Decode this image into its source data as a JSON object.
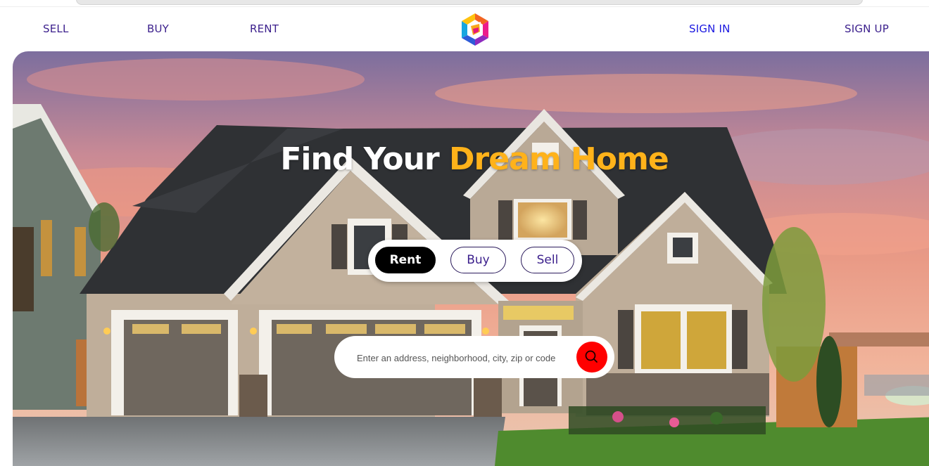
{
  "nav": {
    "sell": "SELL",
    "buy": "BUY",
    "rent": "RENT",
    "sign_in": "SIGN IN",
    "sign_up": "SIGN UP"
  },
  "hero": {
    "headline_part1": "Find Your ",
    "headline_part2": "Dream Home",
    "tabs": [
      {
        "label": "Rent",
        "active": true
      },
      {
        "label": "Buy",
        "active": false
      },
      {
        "label": "Sell",
        "active": false
      }
    ],
    "search": {
      "placeholder": "Enter an address, neighborhood, city, zip or code",
      "value": ""
    }
  },
  "icons": {
    "logo": "hexagon-logo-icon",
    "search": "search-icon"
  },
  "colors": {
    "nav_text": "#3b1f8c",
    "sign_in_text": "#1a17e0",
    "headline_accent": "#ffb21a",
    "search_button": "#ff0000",
    "active_tab": "#000000"
  }
}
